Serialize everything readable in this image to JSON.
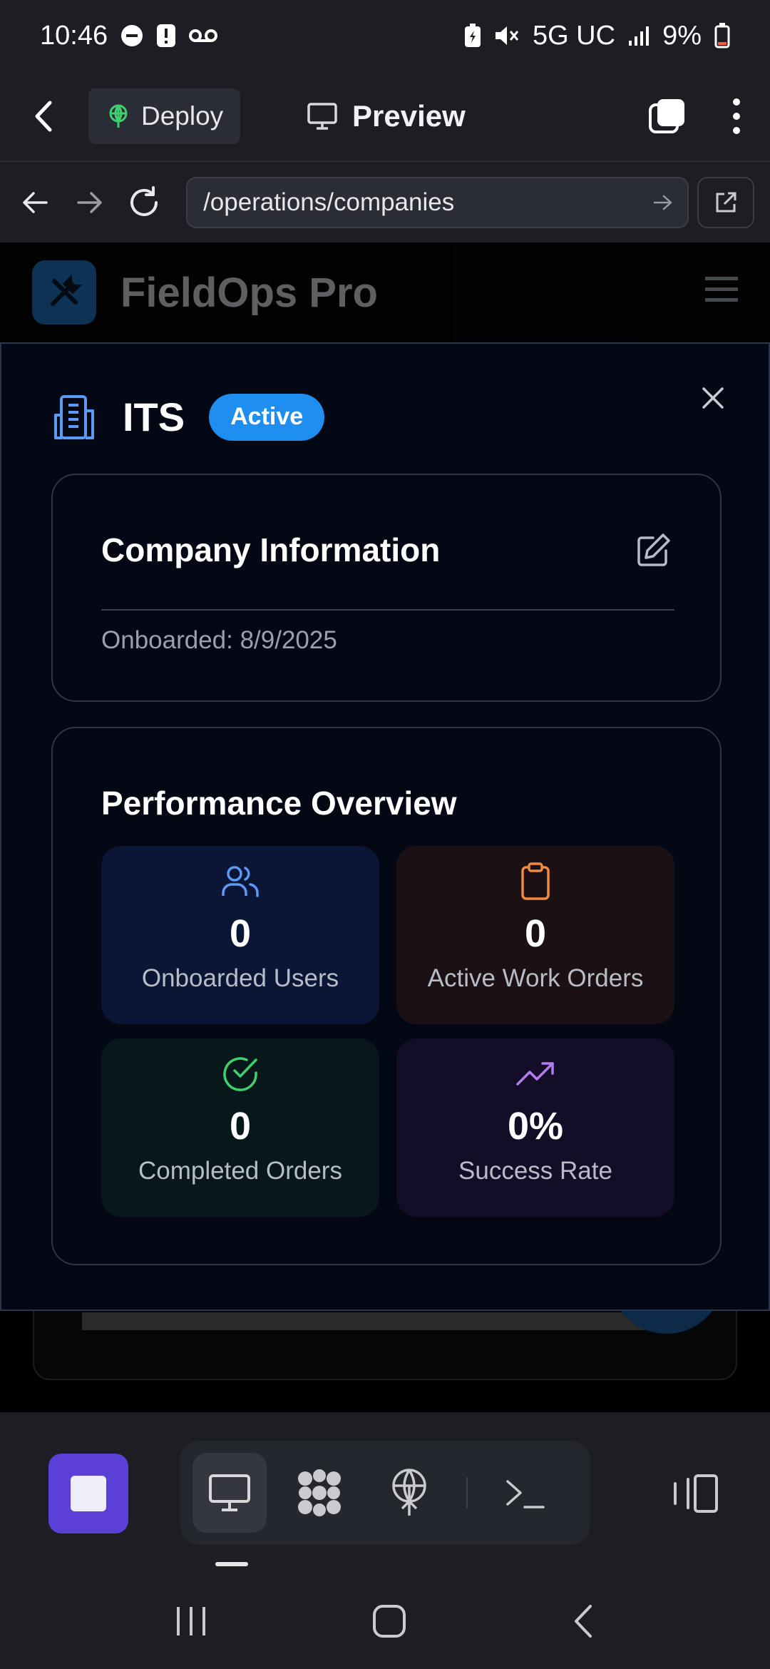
{
  "status_bar": {
    "time": "10:46",
    "network": "5G UC",
    "battery": "9%"
  },
  "header": {
    "deploy_label": "Deploy",
    "preview_label": "Preview"
  },
  "url_bar": {
    "url": "/operations/companies"
  },
  "site": {
    "name": "FieldOps Pro"
  },
  "modal": {
    "title": "ITS",
    "status_badge": "Active",
    "company_info": {
      "title": "Company Information",
      "onboarded": "Onboarded: 8/9/2025"
    },
    "performance": {
      "title": "Performance Overview",
      "tiles": [
        {
          "value": "0",
          "label": "Onboarded Users",
          "icon": "users-icon",
          "color": "#5b9bf5"
        },
        {
          "value": "0",
          "label": "Active Work Orders",
          "icon": "clipboard-icon",
          "color": "#f08a3c"
        },
        {
          "value": "0",
          "label": "Completed Orders",
          "icon": "check-circle-icon",
          "color": "#3fcf6e"
        },
        {
          "value": "0%",
          "label": "Success Rate",
          "icon": "trending-up-icon",
          "color": "#b37cf0"
        }
      ]
    }
  },
  "colors": {
    "badge": "#1f8ef1",
    "stop_button": "#5b3fd6",
    "modal_bg": "#040815"
  }
}
